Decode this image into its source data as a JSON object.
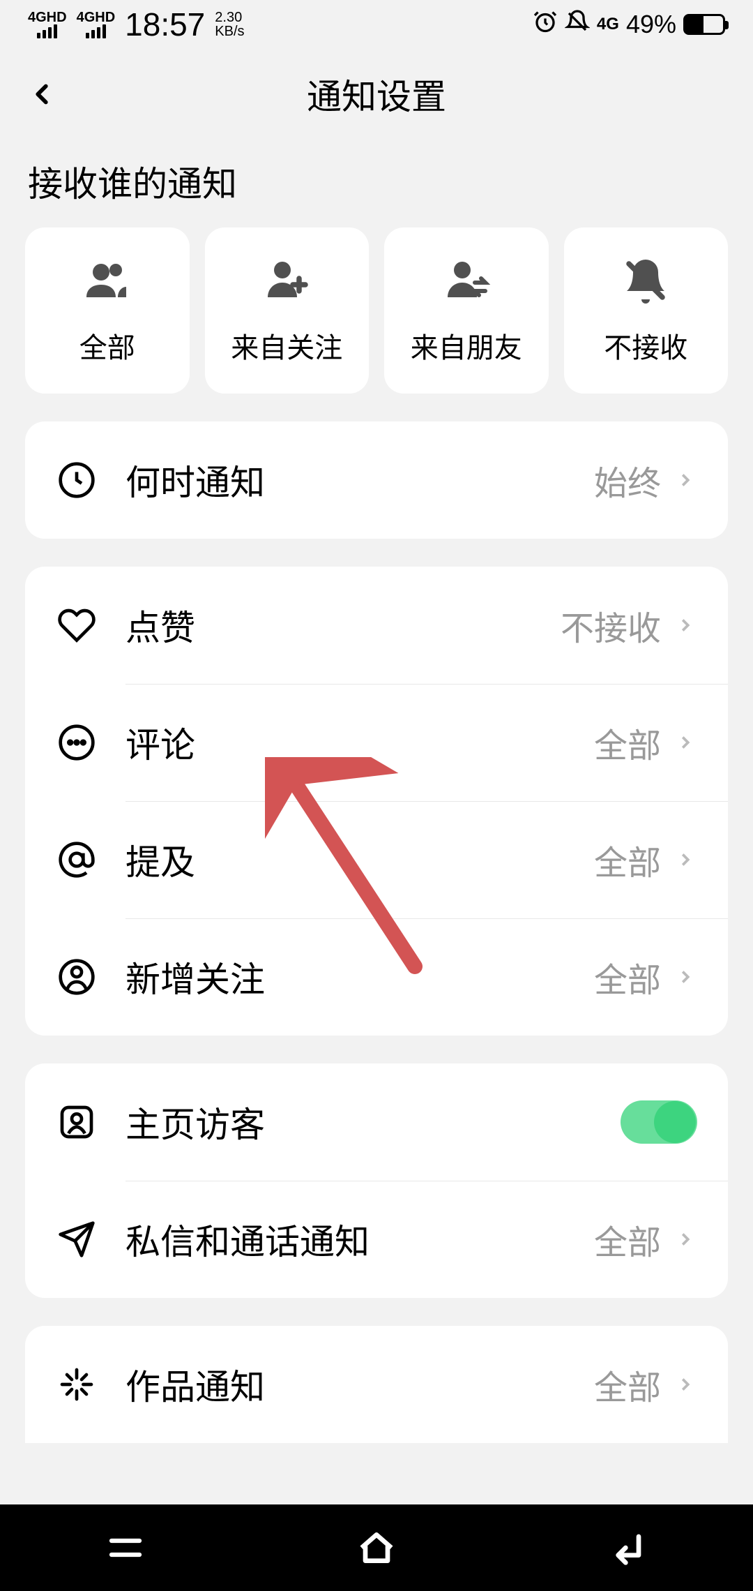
{
  "status": {
    "signal1": "4GHD",
    "signal2": "4GHD",
    "time": "18:57",
    "speed_num": "2.30",
    "speed_unit": "KB/s",
    "network": "4G",
    "battery_pct": "49%"
  },
  "header": {
    "title": "通知设置"
  },
  "section_title": "接收谁的通知",
  "filters": {
    "all": "全部",
    "from_follow": "来自关注",
    "from_friends": "来自朋友",
    "none": "不接收"
  },
  "rows": {
    "when": {
      "label": "何时通知",
      "value": "始终"
    },
    "like": {
      "label": "点赞",
      "value": "不接收"
    },
    "comment": {
      "label": "评论",
      "value": "全部"
    },
    "mention": {
      "label": "提及",
      "value": "全部"
    },
    "new_follow": {
      "label": "新增关注",
      "value": "全部"
    },
    "visitor": {
      "label": "主页访客"
    },
    "dm": {
      "label": "私信和通话通知",
      "value": "全部"
    },
    "works": {
      "label": "作品通知",
      "value": "全部"
    }
  }
}
